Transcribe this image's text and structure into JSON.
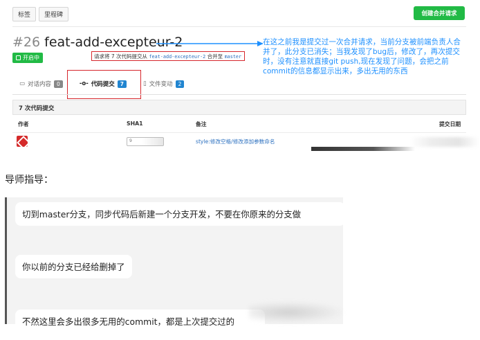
{
  "topbar": {
    "tabs": [
      "标签",
      "里程碑"
    ],
    "create_button": "创建合并请求"
  },
  "pr": {
    "number": "#26",
    "title": "feat-add-excepteur-2",
    "status": "开启中",
    "desc_prefix": "请求将 7 次代码提交从",
    "desc_source": "feat-add-excepteur-2",
    "desc_mid": "合并至",
    "desc_target": "master"
  },
  "annotation": "在这之前我是提交过一次合并请求，当前分支被前端负责人合并了，此分支已消失；当我发现了bug后，修改了，再次提交时，没有注意就直接git push,现在发现了问题，会把之前commit的信息都显示出来，多出无用的东西",
  "tabs": [
    {
      "label": "对话内容",
      "count": "0"
    },
    {
      "label": "代码提交",
      "count": "7"
    },
    {
      "label": "文件变动",
      "count": "2"
    }
  ],
  "commits": {
    "header": "7 次代码提交",
    "columns": {
      "author": "作者",
      "sha": "SHA1",
      "message": "备注",
      "date": "提交日期"
    },
    "rows": [
      {
        "sha": "9",
        "message": "style:修改空格/修改添加参数命名"
      }
    ]
  },
  "chat": {
    "label": "导师指导：",
    "messages": [
      "切到master分支，同步代码后新建一个分支开发，不要在你原来的分支做",
      "你以前的分支已经给删掉了",
      "不然这里会多出很多无用的commit，都是上次提交过的"
    ]
  },
  "colors": {
    "accent_green": "#21ba45",
    "highlight_red": "#d6262b",
    "annotation_blue": "#1e90ff",
    "link_blue": "#2a6fbf"
  }
}
